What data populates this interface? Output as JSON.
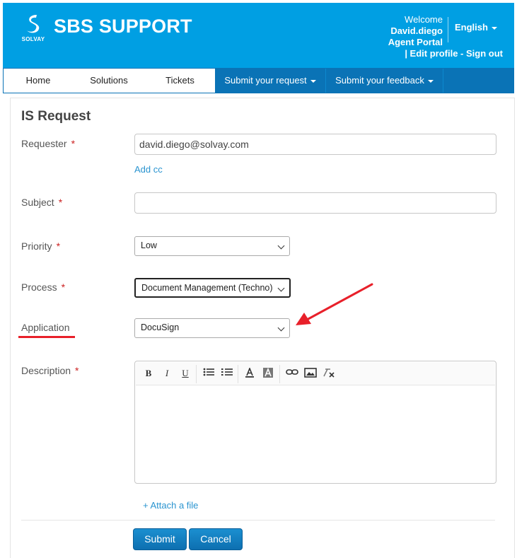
{
  "header": {
    "logo_text": "SOLVAY",
    "title": "SBS SUPPORT",
    "welcome": "Welcome",
    "username": "David.diego",
    "portal": "Agent Portal",
    "links": "| Edit profile - Sign out",
    "language": "English"
  },
  "nav": {
    "items": [
      {
        "label": "Home"
      },
      {
        "label": "Solutions"
      },
      {
        "label": "Tickets"
      },
      {
        "label": "Submit your request"
      },
      {
        "label": "Submit your feedback"
      }
    ]
  },
  "form": {
    "title": "IS Request",
    "requester_label": "Requester",
    "requester_value": "david.diego@solvay.com",
    "add_cc": "Add cc",
    "subject_label": "Subject",
    "subject_value": "",
    "priority_label": "Priority",
    "priority_value": "Low",
    "process_label": "Process",
    "process_value": "Document Management (Techno)",
    "application_label": "Application",
    "application_value": "DocuSign",
    "description_label": "Description",
    "required_mark": "*",
    "attach": "+ Attach a file",
    "submit": "Submit",
    "cancel": "Cancel"
  },
  "toolbar": {
    "bold": "B",
    "italic": "I",
    "underline": "U"
  },
  "colors": {
    "header_bg": "#009fe3",
    "nav_active_bg": "#0a73b6",
    "annotation_red": "#e8202a",
    "link": "#2a94d0"
  }
}
